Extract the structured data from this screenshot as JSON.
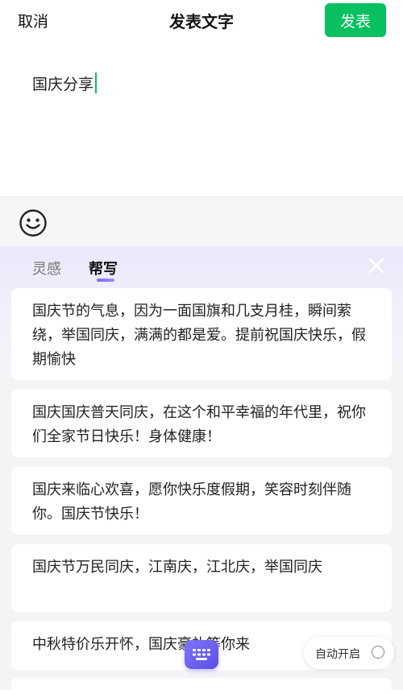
{
  "header": {
    "cancel_label": "取消",
    "title": "发表文字",
    "publish_label": "发表"
  },
  "editor": {
    "text": "国庆分享"
  },
  "panel": {
    "tabs": [
      {
        "label": "灵感"
      },
      {
        "label": "帮写"
      }
    ],
    "active_tab": "帮写",
    "suggestions": [
      "国庆节的气息，因为一面国旗和几支月桂，瞬间萦绕，举国同庆，满满的都是爱。提前祝国庆快乐，假期愉快",
      "国庆国庆普天同庆，在这个和平幸福的年代里，祝你们全家节日快乐！身体健康！",
      "国庆来临心欢喜，愿你快乐度假期，笑容时刻伴随你。国庆节快乐！",
      "国庆节万民同庆，江南庆，江北庆，举国同庆",
      "中秋特价乐开怀，国庆豪礼等你来"
    ],
    "auto_open_label": "自动开启"
  },
  "colors": {
    "publish_green": "#07c160",
    "accent_purple": "#6b5cf0"
  },
  "icons": [
    "emoji-icon",
    "close-icon",
    "keyboard-icon"
  ]
}
